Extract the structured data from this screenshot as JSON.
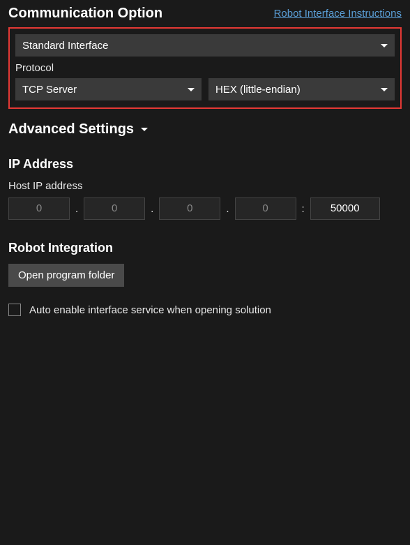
{
  "header": {
    "title": "Communication Option",
    "link": "Robot Interface Instructions"
  },
  "communication": {
    "interface_select": "Standard Interface",
    "protocol_label": "Protocol",
    "protocol_select": "TCP Server",
    "encoding_select": "HEX (little-endian)"
  },
  "advanced": {
    "title": "Advanced Settings"
  },
  "ip": {
    "heading": "IP Address",
    "field_label": "Host IP address",
    "octet1": "0",
    "octet2": "0",
    "octet3": "0",
    "octet4": "0",
    "port": "50000"
  },
  "robot": {
    "heading": "Robot Integration",
    "open_folder_button": "Open program folder"
  },
  "auto_enable": {
    "label": "Auto enable interface service when opening solution"
  }
}
